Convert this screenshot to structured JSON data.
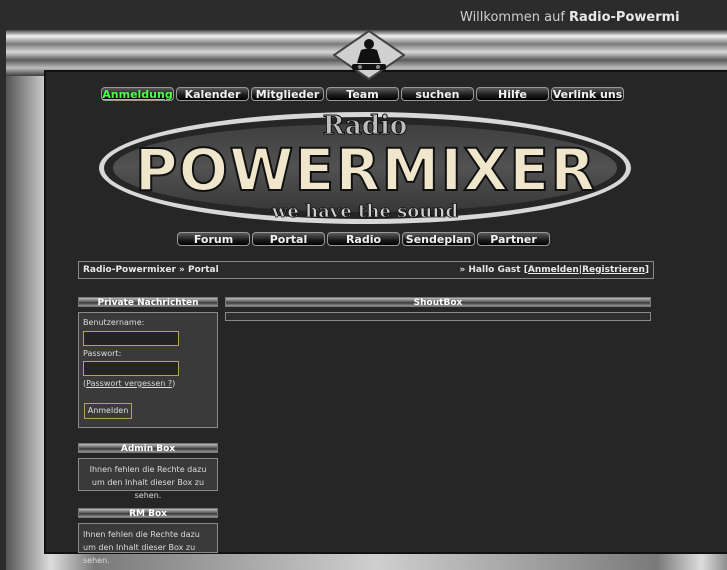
{
  "header": {
    "welcome_prefix": "Willkommen auf ",
    "welcome_site": "Radio-Powermi"
  },
  "top_nav": [
    {
      "label": "Anmeldung",
      "active": true
    },
    {
      "label": "Kalender"
    },
    {
      "label": "Mitglieder"
    },
    {
      "label": "Team"
    },
    {
      "label": "suchen"
    },
    {
      "label": "Hilfe"
    },
    {
      "label": "Verlink uns"
    }
  ],
  "banner": {
    "radio": "Radio",
    "brand": "POWERMIXER",
    "slogan": "we have the sound"
  },
  "bottom_nav": [
    "Forum",
    "Portal",
    "Radio",
    "Sendeplan",
    "Partner"
  ],
  "breadcrumb": {
    "site": "Radio-Powermixer",
    "separator": "»",
    "page": "Portal",
    "greeting": "» Hallo Gast",
    "login": "Anmelden",
    "register": "Registrieren"
  },
  "private_box": {
    "title": "Private Nachrichten",
    "username_label": "Benutzername:",
    "password_label": "Passwort:",
    "forgot_link": "Passwort vergessen ?",
    "login_button": "Anmelden"
  },
  "admin_box": {
    "title": "Admin Box",
    "text": "Ihnen fehlen die Rechte dazu um den Inhalt dieser Box zu sehen."
  },
  "rm_box": {
    "title": "RM Box",
    "text": "Ihnen fehlen die Rechte dazu um den Inhalt dieser Box zu sehen."
  },
  "shoutbox": {
    "title": "ShoutBox"
  },
  "colors": {
    "background": "#2c2c2c",
    "active_nav": "#4cff4c",
    "field_border": "#b6a060"
  }
}
